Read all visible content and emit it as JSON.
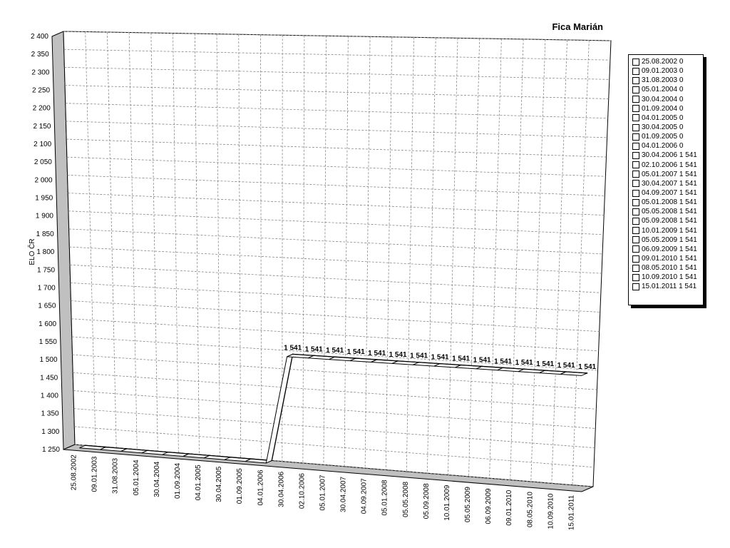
{
  "chart_data": {
    "type": "line",
    "title": "Fica Marián",
    "ylabel": "ELO ČR",
    "xlabel": "",
    "ylim": [
      1250,
      2400
    ],
    "y_ticks": [
      1250,
      1300,
      1350,
      1400,
      1450,
      1500,
      1550,
      1600,
      1650,
      1700,
      1750,
      1800,
      1850,
      1900,
      1950,
      2000,
      2050,
      2100,
      2150,
      2200,
      2250,
      2300,
      2350,
      2400
    ],
    "y_tick_labels": [
      "1 250",
      "1 300",
      "1 350",
      "1 400",
      "1 450",
      "1 500",
      "1 550",
      "1 600",
      "1 650",
      "1 700",
      "1 750",
      "1 800",
      "1 850",
      "1 900",
      "1 950",
      "2 000",
      "2 050",
      "2 100",
      "2 150",
      "2 200",
      "2 250",
      "2 300",
      "2 350",
      "2 400"
    ],
    "grid": true,
    "legend_position": "right",
    "categories": [
      "25.08.2002",
      "09.01.2003",
      "31.08.2003",
      "05.01.2004",
      "30.04.2004",
      "01.09.2004",
      "04.01.2005",
      "30.04.2005",
      "01.09.2005",
      "04.01.2006",
      "30.04.2006",
      "02.10.2006",
      "05.01.2007",
      "30.04.2007",
      "04.09.2007",
      "05.01.2008",
      "05.05.2008",
      "05.09.2008",
      "10.01.2009",
      "05.05.2009",
      "06.09.2009",
      "09.01.2010",
      "08.05.2010",
      "10.09.2010",
      "15.01.2011"
    ],
    "series": [
      {
        "values": [
          0,
          0,
          0,
          0,
          0,
          0,
          0,
          0,
          0,
          0,
          1541,
          1541,
          1541,
          1541,
          1541,
          1541,
          1541,
          1541,
          1541,
          1541,
          1541,
          1541,
          1541,
          1541,
          1541
        ]
      }
    ],
    "data_labels": [
      "",
      "",
      "",
      "",
      "",
      "",
      "",
      "",
      "",
      "",
      "1 541",
      "1 541",
      "1 541",
      "1 541",
      "1 541",
      "1 541",
      "1 541",
      "1 541",
      "1 541",
      "1 541",
      "1 541",
      "1 541",
      "1 541",
      "1 541",
      "1 541"
    ],
    "legend_entries": [
      "25.08.2002 0",
      "09.01.2003 0",
      "31.08.2003 0",
      "05.01.2004 0",
      "30.04.2004 0",
      "01.09.2004 0",
      "04.01.2005 0",
      "30.04.2005 0",
      "01.09.2005 0",
      "04.01.2006 0",
      "30.04.2006 1 541",
      "02.10.2006 1 541",
      "05.01.2007 1 541",
      "30.04.2007 1 541",
      "04.09.2007 1 541",
      "05.01.2008 1 541",
      "05.05.2008 1 541",
      "05.09.2008 1 541",
      "10.01.2009 1 541",
      "05.05.2009 1 541",
      "06.09.2009 1 541",
      "09.01.2010 1 541",
      "08.05.2010 1 541",
      "10.09.2010 1 541",
      "15.01.2011 1 541"
    ],
    "colors": {
      "line": "#000000",
      "band": "#c0c0c0",
      "grid": "#888888"
    }
  }
}
